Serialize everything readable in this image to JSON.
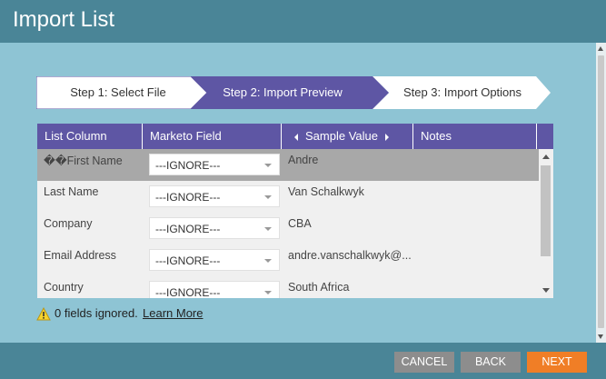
{
  "window": {
    "title": "Import List"
  },
  "steps": [
    {
      "label": "Step 1: Select File",
      "active": false
    },
    {
      "label": "Step 2: Import Preview",
      "active": true
    },
    {
      "label": "Step 3: Import Options",
      "active": false
    }
  ],
  "grid": {
    "columns": [
      "List Column",
      "Marketo Field",
      "Sample Value",
      "Notes"
    ],
    "rows": [
      {
        "column": "��First Name",
        "field": "---IGNORE---",
        "sample": "Andre",
        "selected": true
      },
      {
        "column": "Last Name",
        "field": "---IGNORE---",
        "sample": "Van Schalkwyk",
        "selected": false
      },
      {
        "column": "Company",
        "field": "---IGNORE---",
        "sample": "CBA",
        "selected": false
      },
      {
        "column": "Email Address",
        "field": "---IGNORE---",
        "sample": "andre.vanschalkwyk@...",
        "selected": false
      },
      {
        "column": "Country",
        "field": "---IGNORE---",
        "sample": "South Africa",
        "selected": false
      }
    ]
  },
  "status": {
    "text": "0 fields ignored.",
    "link": "Learn More",
    "icon": "warning-icon"
  },
  "buttons": {
    "cancel": "CANCEL",
    "back": "BACK",
    "next": "NEXT"
  },
  "colors": {
    "header": "#4a8597",
    "content": "#8ec4d4",
    "accent": "#5e56a4",
    "next_button": "#f07e26",
    "secondary_button": "#8d8d8d"
  }
}
